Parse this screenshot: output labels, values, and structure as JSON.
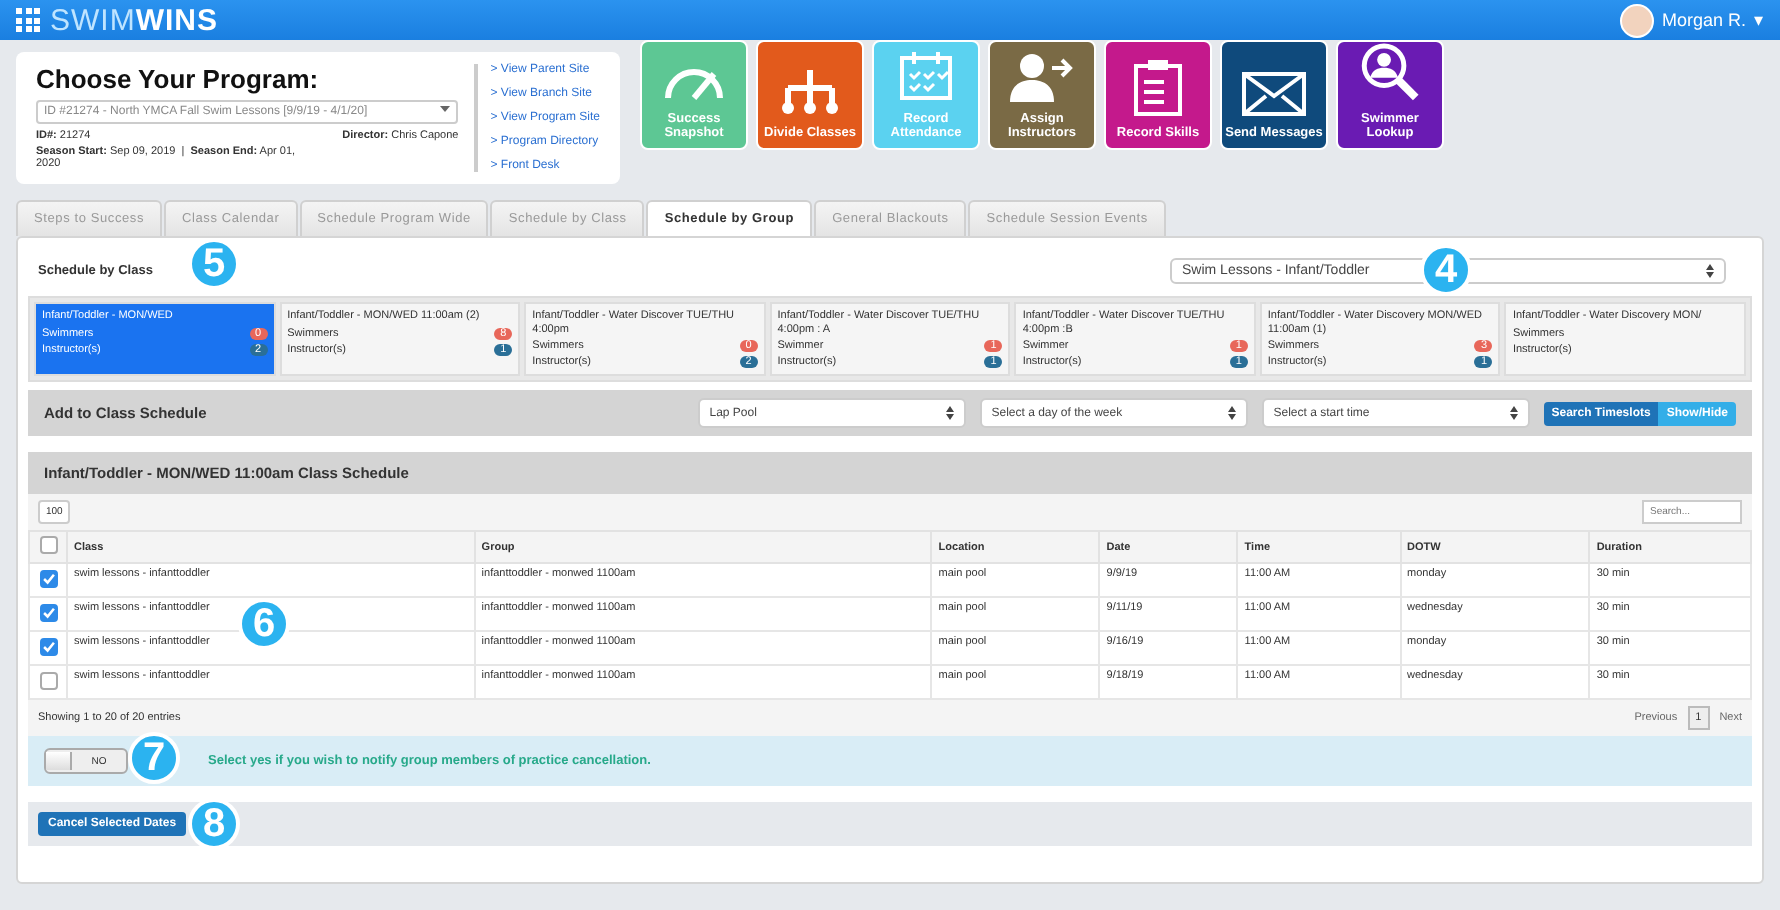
{
  "topbar": {
    "logo": {
      "part_1": "SWIM",
      "part_2": "WINS"
    },
    "user": "Morgan R.",
    "caret": "▾"
  },
  "program": {
    "title": "Choose Your Program:",
    "select": "ID #21274 - North YMCA Fall Swim Lessons [9/9/19 - 4/1/20]",
    "details": [
      {
        "label": "ID#:",
        "value": "21274"
      },
      {
        "label": "Director:",
        "value": "Chris Capone"
      },
      {
        "label": "Season Start:",
        "value": "Sep 09, 2019"
      },
      {
        "label": "Season End:",
        "value": "Apr 01, 2020"
      }
    ],
    "separator": "|",
    "links": [
      "> View Parent Site",
      "> View Branch Site",
      "> View Program Site",
      "> Program Directory",
      "> Front Desk"
    ]
  },
  "tiles": [
    {
      "kind": "gauge",
      "label": "Success Snapshot",
      "color": "#5dc794"
    },
    {
      "kind": "tree",
      "label": "Divide Classes",
      "color": "#e25a1c"
    },
    {
      "kind": "calendar",
      "label": "Record Attendance",
      "color": "#5bd2f0"
    },
    {
      "kind": "person",
      "label": "Assign Instructors",
      "color": "#7a6a45"
    },
    {
      "kind": "clipboard",
      "label": "Record Skills",
      "color": "#c4198c"
    },
    {
      "kind": "mail",
      "label": "Send Messages",
      "color": "#0f4a7c"
    },
    {
      "kind": "lookup",
      "label": "Swimmer Lookup",
      "color": "#6a1bb3"
    }
  ],
  "tabs": [
    {
      "label": "Steps to Success",
      "selected": false
    },
    {
      "label": "Class Calendar",
      "selected": false
    },
    {
      "label": "Schedule Program Wide",
      "selected": false
    },
    {
      "label": "Schedule by Class",
      "selected": false
    },
    {
      "label": "Schedule by Group",
      "selected": true
    },
    {
      "label": "General Blackouts",
      "selected": false
    },
    {
      "label": "Schedule Session Events",
      "selected": false
    }
  ],
  "schedule": {
    "heading": "Schedule by Class",
    "group_select": "Swim Lessons - Infant/Toddler",
    "classes": [
      {
        "name": "Infant/Toddler - MON/WED",
        "swimmers_label": "Swimmers",
        "swimmers": "0",
        "instructors_label": "Instructor(s)",
        "instructors": "2",
        "selected": true
      },
      {
        "name": "Infant/Toddler - MON/WED 11:00am (2)",
        "swimmers_label": "Swimmers",
        "swimmers": "8",
        "instructors_label": "Instructor(s)",
        "instructors": "1",
        "selected": false
      },
      {
        "name": "Infant/Toddler - Water Discover TUE/THU 4:00pm",
        "swimmers_label": "Swimmers",
        "swimmers": "0",
        "instructors_label": "Instructor(s)",
        "instructors": "2",
        "selected": false
      },
      {
        "name": "Infant/Toddler - Water Discover TUE/THU 4:00pm : A",
        "swimmers_label": "Swimmer",
        "swimmers": "1",
        "instructors_label": "Instructor(s)",
        "instructors": "1",
        "selected": false
      },
      {
        "name": "Infant/Toddler - Water Discover TUE/THU 4:00pm :B",
        "swimmers_label": "Swimmer",
        "swimmers": "1",
        "instructors_label": "Instructor(s)",
        "instructors": "1",
        "selected": false
      },
      {
        "name": "Infant/Toddler - Water Discovery MON/WED 11:00am (1)",
        "swimmers_label": "Swimmers",
        "swimmers": "3",
        "instructors_label": "Instructor(s)",
        "instructors": "1",
        "selected": false
      },
      {
        "name": "Infant/Toddler - Water Discovery MON/",
        "swimmers_label": "Swimmers",
        "instructors_label": "Instructor(s)",
        "selected": false
      }
    ],
    "add": {
      "title": "Add to Class Schedule",
      "pool": "Lap Pool",
      "day_placeholder": "Select a day of the week",
      "time_placeholder": "Select a start time",
      "search_button": "Search Timeslots",
      "toggle_button": "Show/Hide"
    },
    "table_title": "Infant/Toddler - MON/WED 11:00am Class Schedule",
    "page_length": "100",
    "search_placeholder": "Search...",
    "table": {
      "all_checked": false,
      "columns": [
        "Class",
        "Group",
        "Location",
        "Date",
        "Time",
        "DOTW",
        "Duration"
      ],
      "rows": [
        {
          "checked": true,
          "cells": [
            "swim lessons - infanttoddler",
            "infanttoddler - monwed 1100am",
            "main pool",
            "9/9/19",
            "11:00 AM",
            "monday",
            "30 min"
          ]
        },
        {
          "checked": true,
          "cells": [
            "swim lessons - infanttoddler",
            "infanttoddler - monwed 1100am",
            "main pool",
            "9/11/19",
            "11:00 AM",
            "wednesday",
            "30 min"
          ]
        },
        {
          "checked": true,
          "cells": [
            "swim lessons - infanttoddler",
            "infanttoddler - monwed 1100am",
            "main pool",
            "9/16/19",
            "11:00 AM",
            "monday",
            "30 min"
          ]
        },
        {
          "checked": false,
          "cells": [
            "swim lessons - infanttoddler",
            "infanttoddler - monwed 1100am",
            "main pool",
            "9/18/19",
            "11:00 AM",
            "wednesday",
            "30 min"
          ]
        }
      ]
    },
    "info": "Showing 1 to 20 of 20 entries",
    "pagination": [
      {
        "label": "Previous",
        "selected": false
      },
      {
        "label": "1",
        "selected": true
      },
      {
        "label": "Next",
        "selected": false
      }
    ],
    "notify": {
      "toggle": {
        "label": "NO",
        "on": false
      },
      "message": "Select yes if you wish to notify group members of practice cancellation."
    },
    "cancel_button": "Cancel Selected Dates"
  },
  "callouts": [
    "4",
    "5",
    "6",
    "7",
    "8"
  ]
}
